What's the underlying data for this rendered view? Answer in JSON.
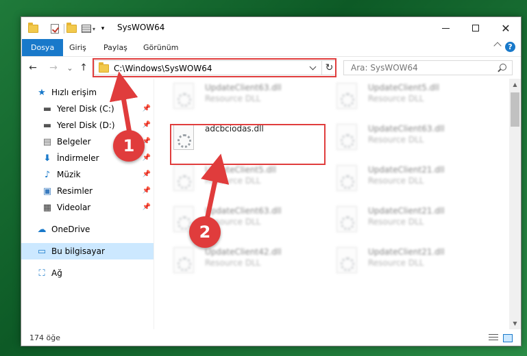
{
  "window": {
    "title": "SysWOW64"
  },
  "ribbon": {
    "tabs": [
      "Dosya",
      "Giriş",
      "Paylaş",
      "Görünüm"
    ],
    "help": "?"
  },
  "nav": {
    "back": "←",
    "forward": "→",
    "recent": "⌄",
    "up": "↑",
    "address": "C:\\Windows\\SysWOW64",
    "refresh": "↻",
    "search_placeholder": "Ara: SysWOW64"
  },
  "sidebar": {
    "items": [
      {
        "label": "Hızlı erişim",
        "icon": "star-icon"
      },
      {
        "label": "Yerel Disk (C:)",
        "icon": "drive-icon"
      },
      {
        "label": "Yerel Disk (D:)",
        "icon": "drive-icon"
      },
      {
        "label": "Belgeler",
        "icon": "document-icon"
      },
      {
        "label": "İndirmeler",
        "icon": "download-icon"
      },
      {
        "label": "Müzik",
        "icon": "music-icon"
      },
      {
        "label": "Resimler",
        "icon": "pictures-icon"
      },
      {
        "label": "Videolar",
        "icon": "video-icon"
      },
      {
        "label": "OneDrive",
        "icon": "cloud-icon"
      },
      {
        "label": "Bu bilgisayar",
        "icon": "computer-icon"
      },
      {
        "label": "Ağ",
        "icon": "network-icon"
      }
    ]
  },
  "files": [
    {
      "name": "UpdateClient63.dll",
      "type": "Resource DLL"
    },
    {
      "name": "UpdateClient5.dll",
      "type": "Resource DLL"
    },
    {
      "name": "adcbciodas.dll",
      "type": ""
    },
    {
      "name": "UpdateClient63.dll",
      "type": "Resource DLL"
    },
    {
      "name": "UpdateClient5.dll",
      "type": "Resource DLL"
    },
    {
      "name": "UpdateClient21.dll",
      "type": "Resource DLL"
    },
    {
      "name": "UpdateClient63.dll",
      "type": "Resource DLL"
    },
    {
      "name": "UpdateClient21.dll",
      "type": "Resource DLL"
    },
    {
      "name": "UpdateClient42.dll",
      "type": "Resource DLL"
    },
    {
      "name": "UpdateClient21.dll",
      "type": "Resource DLL"
    }
  ],
  "status": {
    "count": "174 öğe"
  },
  "callouts": [
    "1",
    "2"
  ],
  "colors": {
    "accent": "#1979ca",
    "highlight": "#e03c3c",
    "selection": "#cce8ff"
  }
}
